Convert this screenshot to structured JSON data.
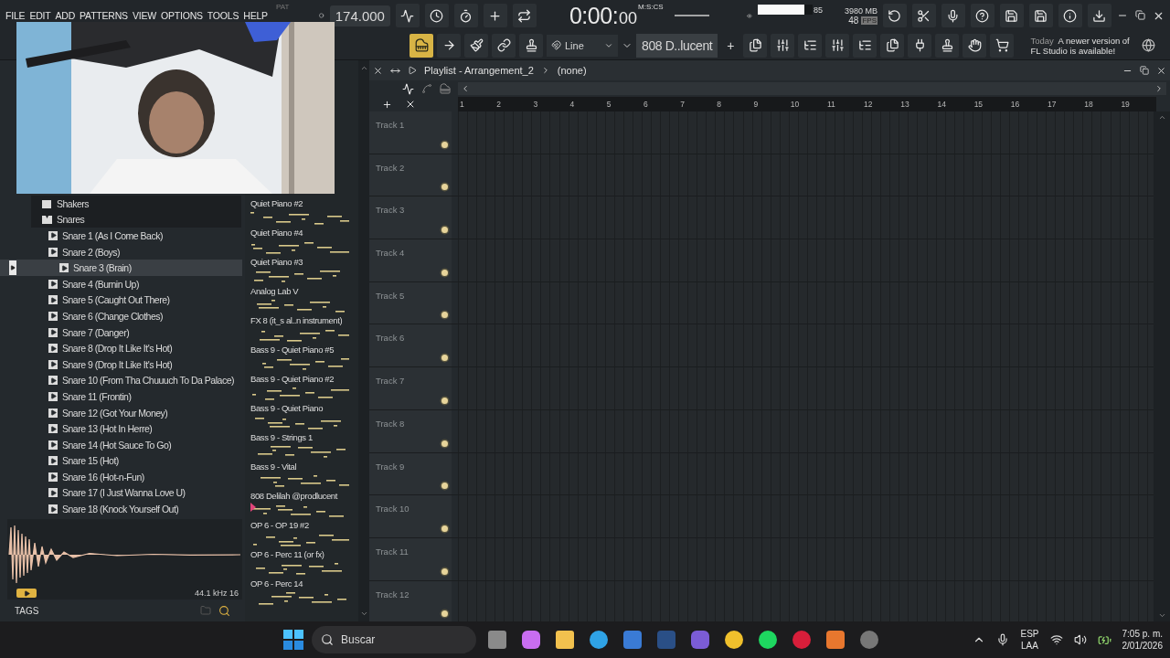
{
  "menu": [
    "FILE",
    "EDIT",
    "ADD",
    "PATTERNS",
    "VIEW",
    "OPTIONS",
    "TOOLS",
    "HELP"
  ],
  "transport": {
    "pat_label": "PAT",
    "tempo": "174.000",
    "time": "0:00:",
    "time_cs": "00",
    "time_format": "M:S:CS"
  },
  "meters": {
    "cpu": {
      "level": 0.85,
      "reading": "85"
    },
    "memory": "3980 MB",
    "polyphony": "48",
    "fps_label": "FPS"
  },
  "toolbar": {
    "snap": "Line",
    "pattern": "808 D..lucent",
    "add": "+"
  },
  "news": {
    "date": "Today",
    "text": "A newer version of FL Studio is available!"
  },
  "browser": {
    "tree": [
      {
        "label": "Shakers",
        "expanded": false
      },
      {
        "label": "Snares",
        "expanded": true,
        "children": [
          {
            "label": "Snare 1 (As I Come Back)",
            "selected": false
          },
          {
            "label": "Snare 2 (Boys)",
            "selected": false
          },
          {
            "label": "Snare 3 (Brain)",
            "selected": true
          },
          {
            "label": "Snare 4 (Burnin Up)",
            "selected": false
          },
          {
            "label": "Snare 5 (Caught Out There)",
            "selected": false
          },
          {
            "label": "Snare 6 (Change Clothes)",
            "selected": false
          },
          {
            "label": "Snare 7 (Danger)",
            "selected": false
          },
          {
            "label": "Snare 8 (Drop It Like It's Hot)",
            "selected": false
          },
          {
            "label": "Snare 9 (Drop It Like It's Hot)",
            "selected": false
          },
          {
            "label": "Snare 10 (From Tha Chuuuch To Da Palace)",
            "selected": false
          },
          {
            "label": "Snare 11 (Frontin)",
            "selected": false
          },
          {
            "label": "Snare 12 (Got Your Money)",
            "selected": false
          },
          {
            "label": "Snare 13 (Hot In Herre)",
            "selected": false
          },
          {
            "label": "Snare 14 (Hot Sauce To Go)",
            "selected": false
          },
          {
            "label": "Snare 15 (Hot)",
            "selected": false
          },
          {
            "label": "Snare 16 (Hot-n-Fun)",
            "selected": false
          },
          {
            "label": "Snare 17 (I Just Wanna Love U)",
            "selected": false
          },
          {
            "label": "Snare 18 (Knock Yourself Out)",
            "selected": false
          }
        ]
      }
    ],
    "sample_info": "44.1 kHz 16",
    "tags_label": "TAGS"
  },
  "patterns": [
    {
      "name": "Quiet Piano #2",
      "selected": false
    },
    {
      "name": "Quiet Piano #4",
      "selected": false
    },
    {
      "name": "Quiet Piano #3",
      "selected": false
    },
    {
      "name": "Analog Lab V",
      "selected": false
    },
    {
      "name": "FX 8 (it_s al..n instrument)",
      "selected": false
    },
    {
      "name": "Bass 9 - Quiet Piano #5",
      "selected": false
    },
    {
      "name": "Bass 9 - Quiet Piano #2",
      "selected": false
    },
    {
      "name": "Bass 9 - Quiet Piano",
      "selected": false
    },
    {
      "name": "Bass 9 - Strings 1",
      "selected": false
    },
    {
      "name": "Bass 9 - Vital",
      "selected": false
    },
    {
      "name": "808 Delilah @prodlucent",
      "selected": true
    },
    {
      "name": "OP 6 - OP 19 #2",
      "selected": false
    },
    {
      "name": "OP 6 - Perc 11 (or fx)",
      "selected": false
    },
    {
      "name": "OP 6 - Perc 14",
      "selected": false
    }
  ],
  "playlist": {
    "title": "Playlist - Arrangement_2",
    "pattern": "(none)",
    "bars": [
      "1",
      "2",
      "3",
      "4",
      "5",
      "6",
      "7",
      "8",
      "9",
      "10",
      "11",
      "12",
      "13",
      "14",
      "15",
      "16",
      "17",
      "18",
      "19"
    ],
    "tracks": [
      "Track 1",
      "Track 2",
      "Track 3",
      "Track 4",
      "Track 5",
      "Track 6",
      "Track 7",
      "Track 8",
      "Track 9",
      "Track 10",
      "Track 11",
      "Track 12"
    ]
  },
  "taskbar": {
    "search_placeholder": "Buscar",
    "language": "ESP",
    "layout": "LAA",
    "time": "7:05 p. m.",
    "date": "2/01/2026"
  }
}
